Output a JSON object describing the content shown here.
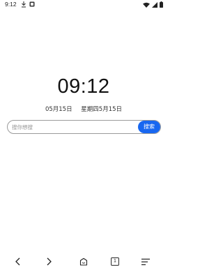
{
  "status_bar": {
    "time": "9:12",
    "icons_left": [
      "download-icon",
      "notification-box-icon"
    ],
    "icons_right": [
      "wifi-icon",
      "signal-icon",
      "battery-icon"
    ]
  },
  "home": {
    "clock": "09:12",
    "date": "05月15日",
    "weekday_date": "星期四5月15日"
  },
  "search": {
    "placeholder": "搜你想搜",
    "value": "",
    "button_label": "搜索",
    "accent_color": "#1867f0"
  },
  "bottom_nav": {
    "items": [
      {
        "icon": "back-icon"
      },
      {
        "icon": "forward-icon"
      },
      {
        "icon": "home-icon"
      },
      {
        "icon": "tabs-icon",
        "count": "1"
      },
      {
        "icon": "menu-icon"
      }
    ]
  }
}
